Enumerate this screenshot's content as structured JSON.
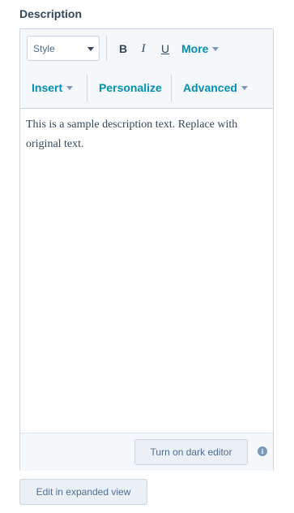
{
  "field": {
    "label": "Description"
  },
  "toolbar": {
    "style_select": {
      "value": "Style"
    },
    "bold_label": "B",
    "italic_label": "I",
    "underline_label": "U",
    "more_label": "More",
    "insert_label": "Insert",
    "personalize_label": "Personalize",
    "advanced_label": "Advanced"
  },
  "editor": {
    "content": "This is a sample description text. Replace with original text."
  },
  "footer": {
    "dark_editor_label": "Turn on dark editor",
    "info_icon": "info-icon"
  },
  "expanded_view_label": "Edit in expanded view",
  "colors": {
    "text": "#33475b",
    "link": "#0091ae",
    "border": "#cbd6e2",
    "toolbar_bg": "#f5f8fa",
    "button_bg": "#eaf0f6"
  }
}
